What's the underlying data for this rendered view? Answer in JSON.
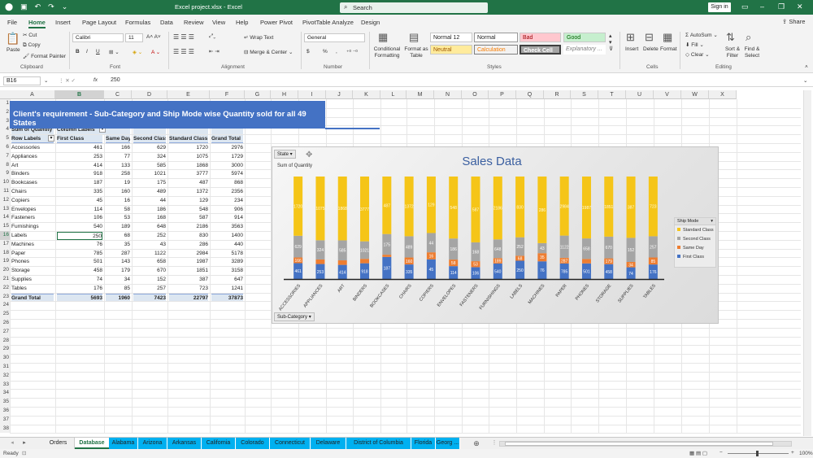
{
  "app": {
    "doc_title": "Excel project.xlsx - Excel",
    "search_placeholder": "Search",
    "signin": "Sign in",
    "share": "Share"
  },
  "menu_tabs": [
    "File",
    "Home",
    "Insert",
    "Page Layout",
    "Formulas",
    "Data",
    "Review",
    "View",
    "Help",
    "Power Pivot",
    "PivotTable Analyze",
    "Design"
  ],
  "ribbon": {
    "clipboard": {
      "paste": "Paste",
      "cut": "Cut",
      "copy": "Copy",
      "format_painter": "Format Painter",
      "label": "Clipboard"
    },
    "font": {
      "name": "Calibri",
      "size": "11",
      "bold": "B",
      "italic": "I",
      "underline": "U",
      "label": "Font"
    },
    "alignment": {
      "wrap": "Wrap Text",
      "merge": "Merge & Center",
      "label": "Alignment"
    },
    "number": {
      "format": "General",
      "currency": "$",
      "percent": "%",
      "comma": ",",
      "label": "Number"
    },
    "styles": {
      "conditional": "Conditional Formatting",
      "format_table": "Format as Table",
      "normal12": "Normal 12",
      "normal": "Normal",
      "bad": "Bad",
      "good": "Good",
      "neutral": "Neutral",
      "calculation": "Calculation",
      "check_cell": "Check Cell",
      "explanatory": "Explanatory ...",
      "label": "Styles"
    },
    "cells": {
      "insert": "Insert",
      "delete": "Delete",
      "format": "Format",
      "label": "Cells"
    },
    "editing": {
      "autosum": "AutoSum",
      "fill": "Fill",
      "clear": "Clear",
      "sort": "Sort & Filter",
      "find": "Find & Select",
      "label": "Editing"
    },
    "colors": {
      "excel_green": "#217346",
      "bad_bg": "#ffc7ce",
      "good_bg": "#c6efce",
      "neutral_bg": "#ffeb9c",
      "check_bg": "#a5a5a5"
    }
  },
  "formula_bar": {
    "name_box": "B16",
    "fx": "fx",
    "value": "250"
  },
  "columns": [
    "A",
    "B",
    "C",
    "D",
    "E",
    "F",
    "G",
    "H",
    "I",
    "J",
    "K",
    "L",
    "M",
    "N",
    "O",
    "P",
    "Q",
    "R",
    "S",
    "T",
    "U",
    "V",
    "W",
    "X"
  ],
  "sheet": {
    "title": "Client's requirement - Sub-Category and Ship Mode wise Quantity sold for all 49 States",
    "state_label": "State",
    "state_value": "(All)",
    "pivot_header": [
      "Sum of Quantity",
      "Column Labels"
    ],
    "headers": [
      "Row Labels",
      "First Class",
      "Same Day",
      "Second Class",
      "Standard Class",
      "Grand Total"
    ],
    "rows": [
      [
        "Accessories",
        "461",
        "166",
        "629",
        "1720",
        "2976"
      ],
      [
        "Appliances",
        "253",
        "77",
        "324",
        "1075",
        "1729"
      ],
      [
        "Art",
        "414",
        "133",
        "585",
        "1868",
        "3000"
      ],
      [
        "Binders",
        "918",
        "258",
        "1021",
        "3777",
        "5974"
      ],
      [
        "Bookcases",
        "187",
        "19",
        "175",
        "487",
        "868"
      ],
      [
        "Chairs",
        "335",
        "160",
        "489",
        "1372",
        "2356"
      ],
      [
        "Copiers",
        "45",
        "16",
        "44",
        "129",
        "234"
      ],
      [
        "Envelopes",
        "114",
        "58",
        "186",
        "548",
        "906"
      ],
      [
        "Fasteners",
        "106",
        "53",
        "168",
        "587",
        "914"
      ],
      [
        "Furnishings",
        "540",
        "189",
        "648",
        "2186",
        "3563"
      ],
      [
        "Labels",
        "250",
        "68",
        "252",
        "830",
        "1400"
      ],
      [
        "Machines",
        "76",
        "35",
        "43",
        "286",
        "440"
      ],
      [
        "Paper",
        "785",
        "287",
        "1122",
        "2984",
        "5178"
      ],
      [
        "Phones",
        "501",
        "143",
        "658",
        "1987",
        "3289"
      ],
      [
        "Storage",
        "458",
        "179",
        "670",
        "1851",
        "3158"
      ],
      [
        "Supplies",
        "74",
        "34",
        "152",
        "387",
        "647"
      ],
      [
        "Tables",
        "176",
        "85",
        "257",
        "723",
        "1241"
      ]
    ],
    "grand_total": [
      "Grand Total",
      "5693",
      "1960",
      "7423",
      "22797",
      "37873"
    ]
  },
  "chart_data": {
    "type": "bar",
    "title": "Sales Data",
    "filter_button": "State",
    "value_button": "Sum of Quantity",
    "axis_button": "Sub-Category",
    "legend_title": "Ship Mode",
    "stacked": true,
    "percent_stacked": true,
    "categories": [
      "ACCESSORIES",
      "APPLIANCES",
      "ART",
      "BINDERS",
      "BOOKCASES",
      "CHAIRS",
      "COPIERS",
      "ENVELOPES",
      "FASTENERS",
      "FURNISHINGS",
      "LABELS",
      "MACHINES",
      "PAPER",
      "PHONES",
      "STORAGE",
      "SUPPLIES",
      "TABLES"
    ],
    "series": [
      {
        "name": "First Class",
        "color": "#4472c4",
        "values": [
          461,
          253,
          414,
          918,
          187,
          335,
          45,
          114,
          106,
          540,
          250,
          76,
          785,
          501,
          458,
          74,
          176
        ]
      },
      {
        "name": "Same Day",
        "color": "#ed7d31",
        "values": [
          166,
          77,
          133,
          258,
          19,
          160,
          16,
          58,
          53,
          189,
          68,
          35,
          287,
          143,
          179,
          34,
          85
        ]
      },
      {
        "name": "Second Class",
        "color": "#a5a5a5",
        "values": [
          629,
          324,
          585,
          1021,
          175,
          489,
          44,
          186,
          168,
          648,
          252,
          43,
          1122,
          658,
          670,
          152,
          257
        ]
      },
      {
        "name": "Standard Class",
        "color": "#f5c518",
        "values": [
          1720,
          1075,
          1868,
          3777,
          487,
          1372,
          129,
          548,
          587,
          2186,
          830,
          286,
          2984,
          1987,
          1851,
          387,
          723
        ]
      }
    ],
    "legend_order": [
      "Standard Class",
      "Second Class",
      "Same Day",
      "First Class"
    ],
    "legend_position": "right"
  },
  "sheet_tabs": [
    "Orders",
    "Database",
    "Alabama",
    "Arizona",
    "Arkansas",
    "California",
    "Colorado",
    "Connecticut",
    "Delaware",
    "District of Columbia",
    "Florida",
    "Georg ..."
  ],
  "active_sheet": "Database",
  "status": {
    "ready": "Ready",
    "zoom": "100%"
  }
}
